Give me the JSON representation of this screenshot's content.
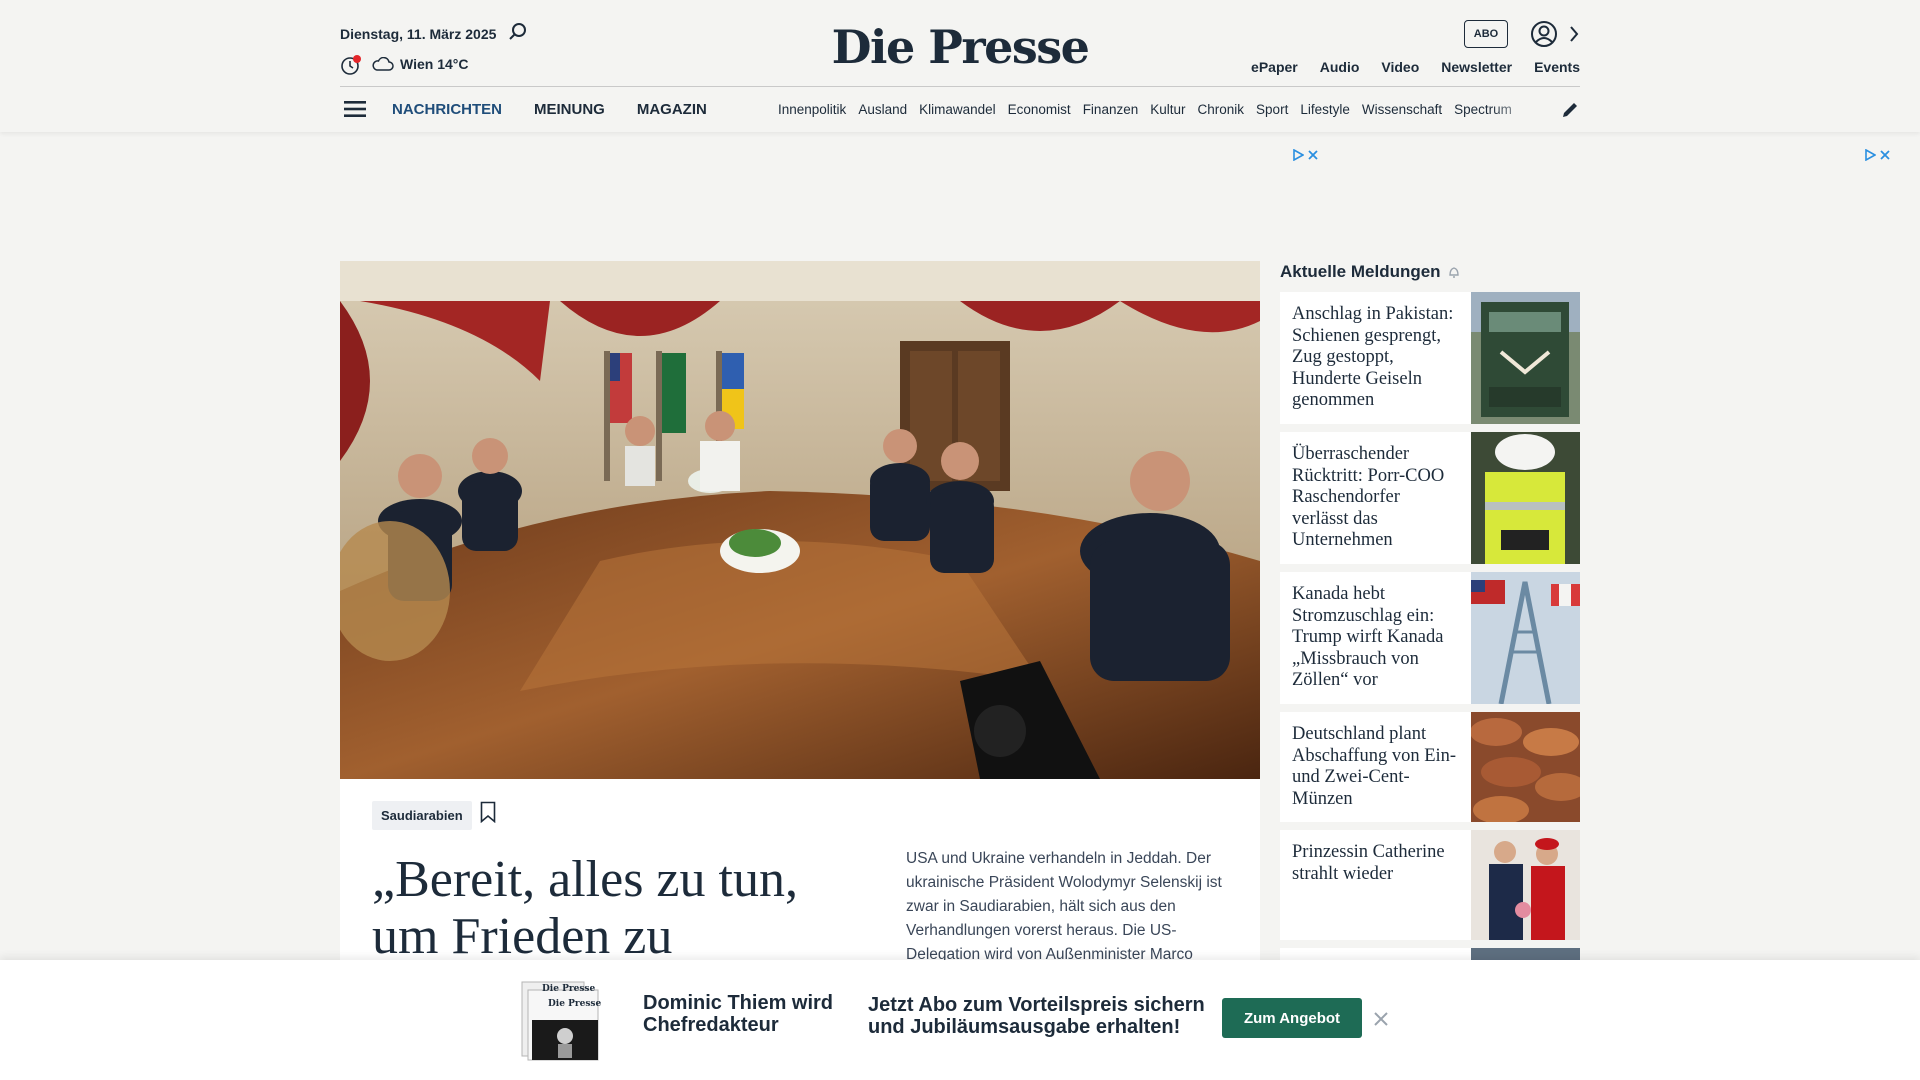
{
  "header": {
    "date": "Dienstag, 11. März 2025",
    "weather": "Wien 14°C",
    "logo": "Die Presse",
    "abo_label": "ABO",
    "top_links": [
      "ePaper",
      "Audio",
      "Video",
      "Newsletter",
      "Events"
    ],
    "main_nav": [
      "NACHRICHTEN",
      "MEINUNG",
      "MAGAZIN"
    ],
    "sub_nav": [
      "Innenpolitik",
      "Ausland",
      "Klimawandel",
      "Economist",
      "Finanzen",
      "Kultur",
      "Chronik",
      "Sport",
      "Lifestyle",
      "Wissenschaft",
      "Spectrum"
    ]
  },
  "hero": {
    "tag": "Saudiarabien",
    "headline": "„Bereit, alles zu tun, um Frieden zu",
    "teaser": "USA und Ukraine verhandeln in Jeddah. Der ukrainische Präsident Wolodymyr Selenskij ist zwar in Saudiarabien, hält sich aus den Verhandlungen vorerst heraus. Die US-Delegation wird von Außenminister Marco"
  },
  "sidebar": {
    "title": "Aktuelle Meldungen",
    "items": [
      {
        "text": "Anschlag in Pakistan: Schienen gesprengt, Zug gestoppt, Hunderte Geiseln genommen",
        "thumb": "train-photo"
      },
      {
        "text": "Überraschender Rücktritt: Porr-COO Raschendorfer verlässt das Unternehmen",
        "thumb": "workers-photo"
      },
      {
        "text": "Kanada hebt Stromzuschlag ein: Trump wirft Kanada „Missbrauch von Zöllen“ vor",
        "thumb": "bridge-photo"
      },
      {
        "text": "Deutschland plant Abschaffung von Ein- und Zwei-Cent-Münzen",
        "thumb": "coins-photo"
      },
      {
        "text": "Prinzessin Catherine strahlt wieder",
        "thumb": "royals-photo"
      }
    ]
  },
  "promo": {
    "title": "Dominic Thiem wird Chefredakteur",
    "text": "Jetzt Abo zum Vorteilspreis sichern und Jubiläumsausgabe erhalten!",
    "button": "Zum Angebot",
    "paper_logo": "Die Presse"
  },
  "colors": {
    "accent": "#1f4d7a",
    "promo_button": "#1e6b55",
    "notification_dot": "#e3262a",
    "ad_icon": "#2a8fe0"
  },
  "icons": [
    "search-icon",
    "clock-icon",
    "cloud-icon",
    "user-icon",
    "chevron-right-icon",
    "menu-icon",
    "edit-icon",
    "bookmark-icon",
    "bell-icon",
    "close-icon",
    "ad-play-icon"
  ]
}
